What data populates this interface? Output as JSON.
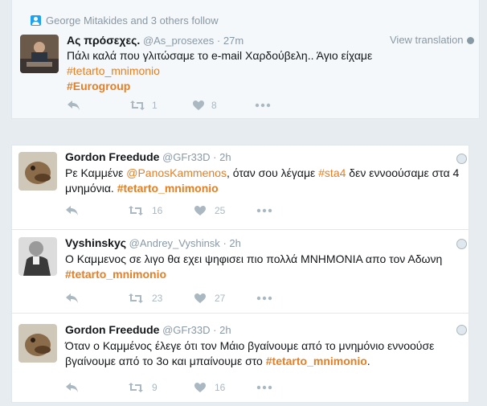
{
  "social_context": "George Mitakides and 3 others follow",
  "view_translation": "View translation",
  "tweets": [
    {
      "name": "Ας πρόσεχες.",
      "handle": "@As_prosexes",
      "time": "27m",
      "line1": "Πάλι καλά που γλιτώσαμε το e-mail Χαρδούβελη.. Άγιο είχαμε",
      "tag1": "#tetarto_mnimonio",
      "tag2": "#Eurogroup",
      "retweets": "1",
      "likes": "8"
    },
    {
      "name": "Gordon Freedude",
      "handle": "@GFr33D",
      "time": "2h",
      "t1": "Ρε Καμμένε ",
      "mention": "@PanosKammenos",
      "t2": ", όταν σου λέγαμε ",
      "tag_sta4": "#sta4",
      "t3": " δεν εννοούσαμε στα 4",
      "t4": "μνημόνια. ",
      "tag": "#tetarto_mnimonio",
      "retweets": "16",
      "likes": "25"
    },
    {
      "name": "Vyshinskyς",
      "handle": "@Andrey_Vyshinsk",
      "time": "2h",
      "line1": "Ο Καμμενος σε λιγο θα εχει ψηφισει πιο πολλά ΜΝΗΜΟΝΙΑ απο τον Αδωνη",
      "tag": "#tetarto_mnimonio",
      "retweets": "23",
      "likes": "27"
    },
    {
      "name": "Gordon Freedude",
      "handle": "@GFr33D",
      "time": "2h",
      "line1": "Όταν ο Καμμένος έλεγε ότι τον Μάιο βγαίνουμε από το μνημόνιο εννοούσε",
      "line2": "βγαίνουμε από το 3ο και μπαίνουμε στο ",
      "tag": "#tetarto_mnimonio",
      "line2_end": ".",
      "retweets": "9",
      "likes": "16"
    }
  ]
}
